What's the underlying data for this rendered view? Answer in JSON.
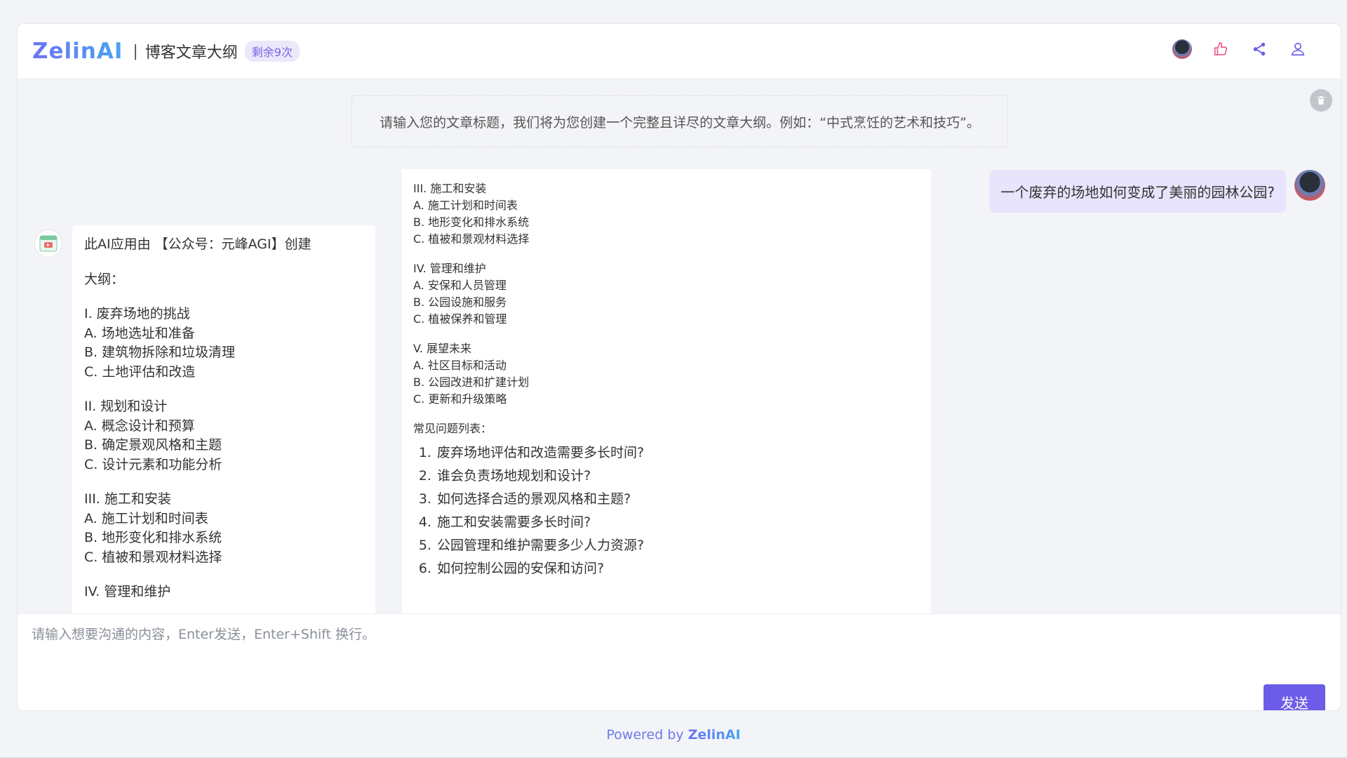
{
  "header": {
    "logo": "ZelinAI",
    "separator": "|",
    "title": "博客文章大纲",
    "badge": "剩余9次"
  },
  "icons": {
    "avatar": "user-avatar-icon",
    "like": "thumbs-up-icon",
    "share": "share-icon",
    "account": "person-icon",
    "clear": "trash-icon",
    "bot": "bot-app-icon"
  },
  "intro": "请输入您的文章标题，我们将为您创建一个完整且详尽的文章大纲。例如：“中式烹饪的艺术和技巧”。",
  "user_message": "一个废弃的场地如何变成了美丽的园林公园?",
  "bot_message_1": {
    "credit": "此AI应用由 【公众号：元峰AGI】创建",
    "outline_label": "大纲：",
    "sections": [
      {
        "lines": [
          "I. 废弃场地的挑战",
          "A. 场地选址和准备",
          "B. 建筑物拆除和垃圾清理",
          "C. 土地评估和改造"
        ]
      },
      {
        "lines": [
          "II. 规划和设计",
          "A. 概念设计和预算",
          "B. 确定景观风格和主题",
          "C. 设计元素和功能分析"
        ]
      },
      {
        "lines": [
          "III. 施工和安装",
          "A. 施工计划和时间表",
          "B. 地形变化和排水系统",
          "C. 植被和景观材料选择"
        ]
      },
      {
        "lines": [
          "IV. 管理和维护"
        ]
      }
    ]
  },
  "bot_message_2": {
    "sections": [
      {
        "lines": [
          "III. 施工和安装",
          "A. 施工计划和时间表",
          "B. 地形变化和排水系统",
          "C. 植被和景观材料选择"
        ]
      },
      {
        "lines": [
          "IV. 管理和维护",
          "A. 安保和人员管理",
          "B. 公园设施和服务",
          "C. 植被保养和管理"
        ]
      },
      {
        "lines": [
          "V. 展望未来",
          "A. 社区目标和活动",
          "B. 公园改进和扩建计划",
          "C. 更新和升级策略"
        ]
      }
    ],
    "faq_label": "常见问题列表：",
    "faq": [
      "废弃场地评估和改造需要多长时间?",
      "谁会负责场地规划和设计?",
      "如何选择合适的景观风格和主题?",
      "施工和安装需要多长时间?",
      "公园管理和维护需要多少人力资源?",
      "如何控制公园的安保和访问?"
    ]
  },
  "composer": {
    "placeholder": "请输入想要沟通的内容，Enter发送，Enter+Shift 换行。",
    "send_label": "发送"
  },
  "footer": {
    "powered": "Powered by",
    "brand": "ZelinAI"
  },
  "colors": {
    "accent": "#6c5ce7",
    "badge_bg": "#ece8fb",
    "user_bubble": "#e7e4fb"
  }
}
